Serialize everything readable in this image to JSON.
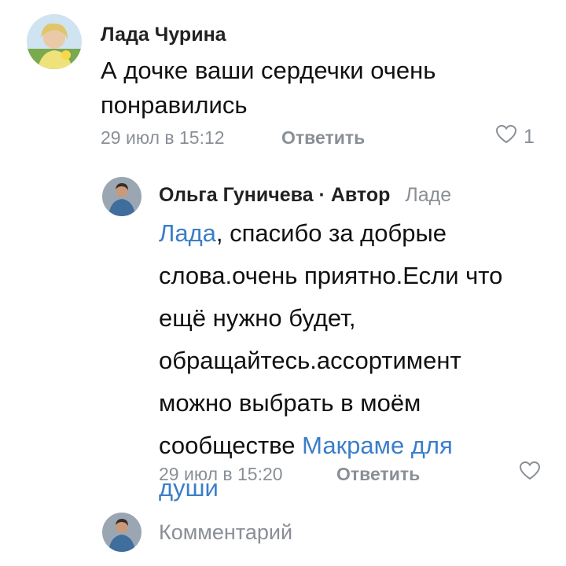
{
  "comment": {
    "author": "Лада Чурина",
    "text": "А дочке ваши сердечки очень понравились",
    "date": "29 июл в 15:12",
    "reply_label": "Ответить",
    "likes": "1"
  },
  "reply": {
    "author": "Ольга Гуничева",
    "author_badge": "· Автор",
    "addressee": "Ладе",
    "mention": "Лада",
    "text_before_link": ", спасибо за добрые слова.очень приятно.Если что ещё нужно будет, обращайтесь.ассортимент можно выбрать в моём сообществе",
    "community_link": "Макраме для души",
    "date": "29 июл в 15:20",
    "reply_label": "Ответить"
  },
  "composer": {
    "placeholder": "Комментарий"
  },
  "colors": {
    "link": "#3b7ec8",
    "muted": "#8a8f96",
    "text": "#111111"
  }
}
